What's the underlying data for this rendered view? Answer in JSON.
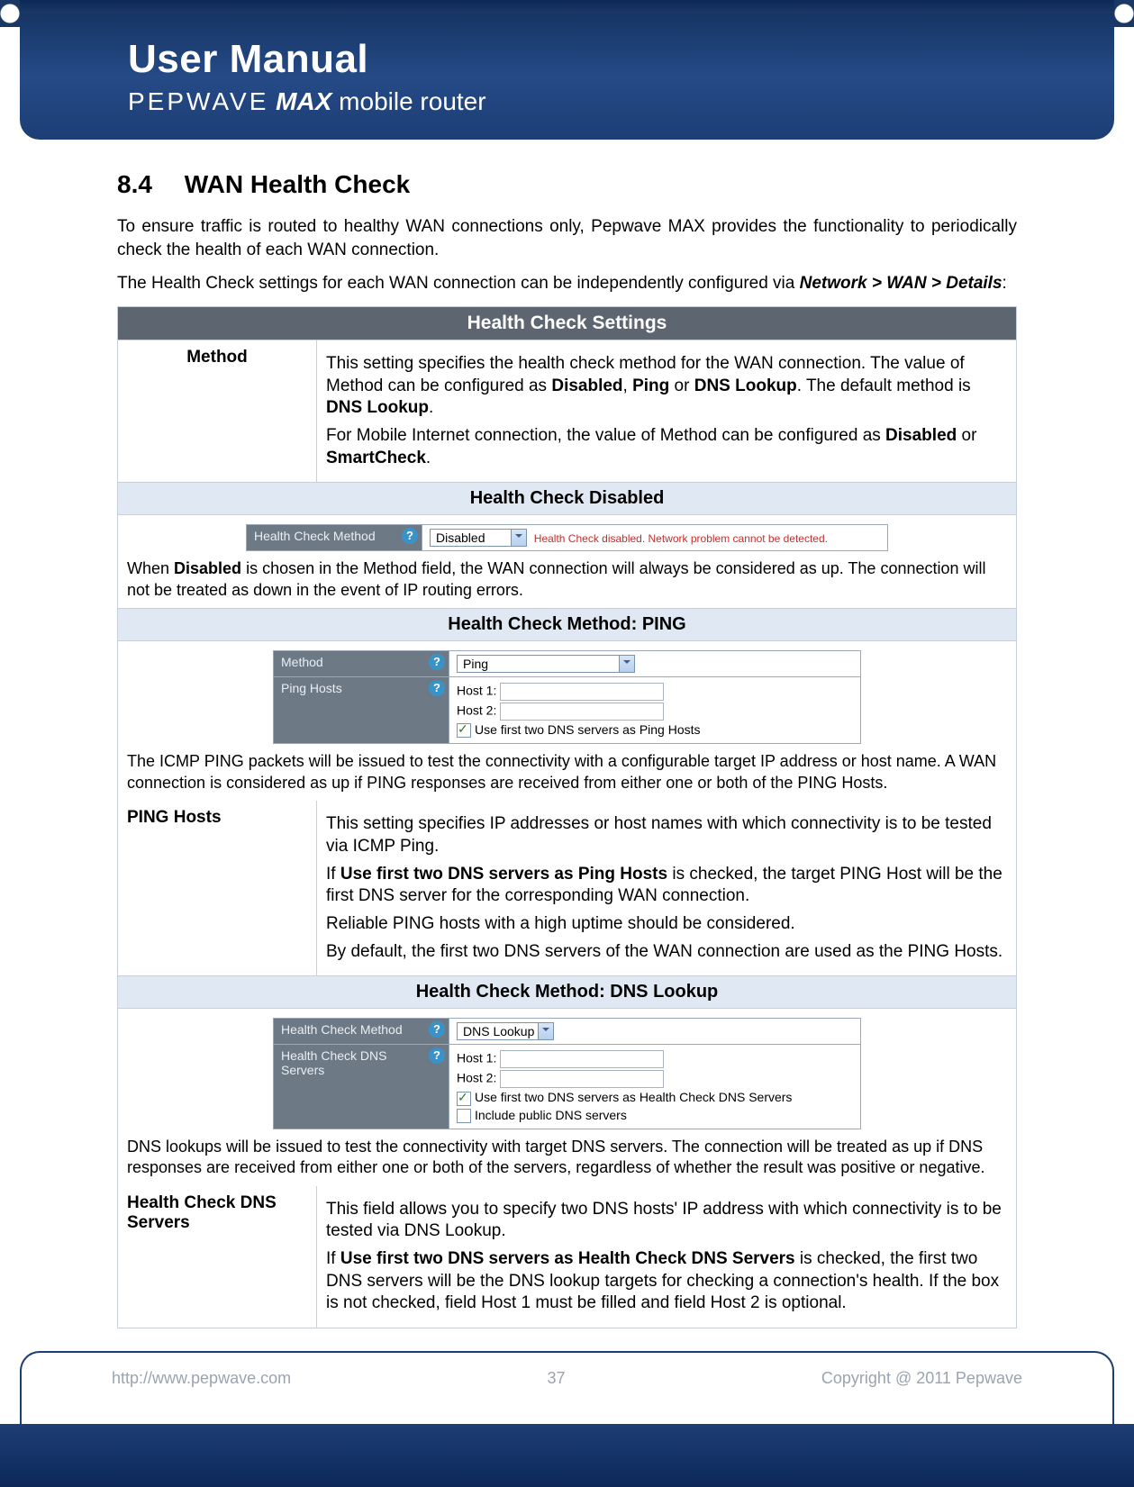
{
  "header": {
    "title": "User Manual",
    "subtitle_brand": "PEPWAVE",
    "subtitle_product": "MAX",
    "subtitle_tail": " mobile router"
  },
  "section": {
    "number": "8.4",
    "title": "WAN Health Check"
  },
  "intro": {
    "p1": "To ensure traffic is routed to healthy WAN connections only, Pepwave MAX provides the functionality to periodically check the health of each WAN connection.",
    "p2_a": "The Health Check settings for each WAN connection can be independently configured via ",
    "p2_path": "Network > WAN > Details",
    "p2_b": ":"
  },
  "table": {
    "main_header": "Health Check Settings",
    "method": {
      "label": "Method",
      "p1_a": "This setting specifies the health check method for the WAN connection. The value of Method can be configured as ",
      "p1_b1": "Disabled",
      "p1_b2": "Ping",
      "p1_b3": "DNS Lookup",
      "p1_c": ". The default method is ",
      "p1_d": "DNS Lookup",
      "p1_e": ".",
      "p2_a": "For Mobile Internet connection, the value of Method can be configured as ",
      "p2_b1": "Disabled",
      "p2_b2": "SmartCheck",
      "p2_c": "."
    },
    "disabled": {
      "header": "Health Check Disabled",
      "form_label": "Health Check Method",
      "select_value": "Disabled",
      "warn": "Health Check disabled. Network problem cannot be detected.",
      "note_a": "When ",
      "note_b": "Disabled",
      "note_c": " is chosen in the Method field, the WAN connection will always be considered as up.  The connection will not be treated as down in the event of IP routing errors."
    },
    "ping": {
      "header": "Health Check Method: PING",
      "label_method": "Method",
      "select_value": "Ping",
      "label_hosts": "Ping Hosts",
      "host1": "Host 1:",
      "host2": "Host 2:",
      "cb_label": "Use first two DNS servers as Ping Hosts",
      "note": "The ICMP PING packets will be issued to test the connectivity with a configurable target IP address or host name. A WAN connection is considered as up if PING responses are received from either one or both of the PING Hosts.",
      "row_label": "PING Hosts",
      "d1": "This setting specifies IP addresses or host names with which connectivity is to be tested via ICMP Ping.",
      "d2_a": "If ",
      "d2_b": "Use first two DNS servers as Ping Hosts",
      "d2_c": " is checked, the target PING Host will be the first DNS server for the corresponding WAN connection.",
      "d3": "Reliable PING hosts with a high uptime should be considered.",
      "d4": "By default, the first two DNS servers of the WAN connection are used as the PING Hosts."
    },
    "dns": {
      "header": "Health Check Method: DNS Lookup",
      "label_method": "Health Check Method",
      "select_value": "DNS Lookup",
      "label_servers": "Health Check DNS Servers",
      "host1": "Host 1:",
      "host2": "Host 2:",
      "cb1": "Use first two DNS servers as Health Check DNS Servers",
      "cb2": "Include public DNS servers",
      "note": "DNS lookups will be issued to test the connectivity with target DNS servers. The connection will be treated as up if DNS responses are received from either one or both of the servers, regardless of whether the result was positive or negative.",
      "row_label": "Health Check DNS Servers",
      "d1": "This field allows you to specify two DNS hosts' IP address with which connectivity is to be tested via DNS Lookup.",
      "d2_a": "If ",
      "d2_b": "Use first two DNS servers as Health Check DNS Servers",
      "d2_c": " is checked, ",
      "d2_d": "the first two DNS servers will be the DNS lookup targets for checking a connection's health. If the box is not checked, field Host 1 must be filled and field Host 2 is optional."
    }
  },
  "footer": {
    "url": "http://www.pepwave.com",
    "page": "37",
    "copyright": "Copyright @ 2011 Pepwave"
  }
}
